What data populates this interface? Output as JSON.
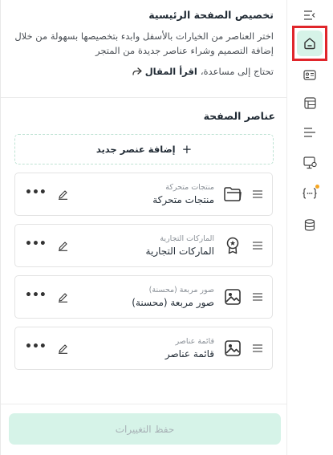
{
  "header": {
    "title": "تخصيص الصفحة الرئيسية",
    "description": "اختر العناصر من الخيارات بالأسفل وابدء بتخصيصها بسهولة من خلال إضافة التصميم وشراء عناصر جديدة من المتجر",
    "help_text": "تحتاج إلى مساعدة،",
    "help_link": "اقرأ المقال"
  },
  "section": {
    "title": "عناصر الصفحة",
    "add_label": "إضافة عنصر جديد"
  },
  "items": [
    {
      "subtitle": "منتجات متحركة",
      "name": "منتجات متحركة",
      "icon": "folder-icon"
    },
    {
      "subtitle": "الماركات التجارية",
      "name": "الماركات التجارية",
      "icon": "badge-icon"
    },
    {
      "subtitle": "صور مربعة (محسنة)",
      "name": "صور مربعة (محسنة)",
      "icon": "image-icon"
    },
    {
      "subtitle": "قائمة عناصر",
      "name": "قائمة عناصر",
      "icon": "image-icon"
    }
  ],
  "footer": {
    "save_label": "حفظ التغييرات"
  },
  "rail": {
    "icons": [
      "collapse-icon",
      "home-icon",
      "id-card-icon",
      "layout-icon",
      "list-icon",
      "monitor-icon",
      "code-icon",
      "database-icon"
    ],
    "notification_color": "#f5a623",
    "highlight_color": "#e0262b"
  },
  "colors": {
    "accent_light": "#d6f3e8",
    "border": "#e3e3e3"
  }
}
